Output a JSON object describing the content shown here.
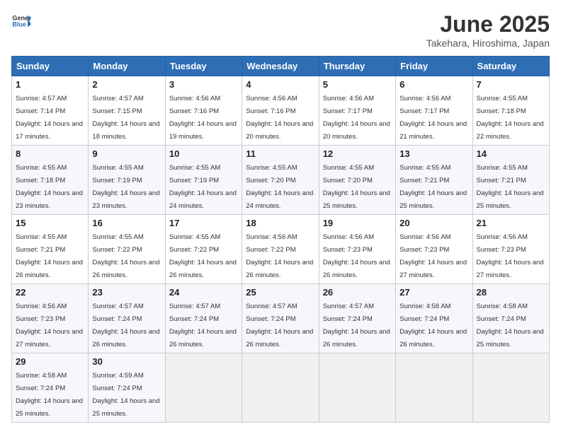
{
  "header": {
    "logo_general": "General",
    "logo_blue": "Blue",
    "title": "June 2025",
    "subtitle": "Takehara, Hiroshima, Japan"
  },
  "calendar": {
    "days_of_week": [
      "Sunday",
      "Monday",
      "Tuesday",
      "Wednesday",
      "Thursday",
      "Friday",
      "Saturday"
    ],
    "weeks": [
      [
        {
          "day": "",
          "sunrise": "",
          "sunset": "",
          "daylight": ""
        },
        {
          "day": "2",
          "sunrise": "4:57 AM",
          "sunset": "7:15 PM",
          "daylight": "14 hours and 18 minutes."
        },
        {
          "day": "3",
          "sunrise": "4:56 AM",
          "sunset": "7:16 PM",
          "daylight": "14 hours and 19 minutes."
        },
        {
          "day": "4",
          "sunrise": "4:56 AM",
          "sunset": "7:16 PM",
          "daylight": "14 hours and 20 minutes."
        },
        {
          "day": "5",
          "sunrise": "4:56 AM",
          "sunset": "7:17 PM",
          "daylight": "14 hours and 20 minutes."
        },
        {
          "day": "6",
          "sunrise": "4:56 AM",
          "sunset": "7:17 PM",
          "daylight": "14 hours and 21 minutes."
        },
        {
          "day": "7",
          "sunrise": "4:55 AM",
          "sunset": "7:18 PM",
          "daylight": "14 hours and 22 minutes."
        }
      ],
      [
        {
          "day": "8",
          "sunrise": "4:55 AM",
          "sunset": "7:18 PM",
          "daylight": "14 hours and 23 minutes."
        },
        {
          "day": "9",
          "sunrise": "4:55 AM",
          "sunset": "7:19 PM",
          "daylight": "14 hours and 23 minutes."
        },
        {
          "day": "10",
          "sunrise": "4:55 AM",
          "sunset": "7:19 PM",
          "daylight": "14 hours and 24 minutes."
        },
        {
          "day": "11",
          "sunrise": "4:55 AM",
          "sunset": "7:20 PM",
          "daylight": "14 hours and 24 minutes."
        },
        {
          "day": "12",
          "sunrise": "4:55 AM",
          "sunset": "7:20 PM",
          "daylight": "14 hours and 25 minutes."
        },
        {
          "day": "13",
          "sunrise": "4:55 AM",
          "sunset": "7:21 PM",
          "daylight": "14 hours and 25 minutes."
        },
        {
          "day": "14",
          "sunrise": "4:55 AM",
          "sunset": "7:21 PM",
          "daylight": "14 hours and 25 minutes."
        }
      ],
      [
        {
          "day": "15",
          "sunrise": "4:55 AM",
          "sunset": "7:21 PM",
          "daylight": "14 hours and 26 minutes."
        },
        {
          "day": "16",
          "sunrise": "4:55 AM",
          "sunset": "7:22 PM",
          "daylight": "14 hours and 26 minutes."
        },
        {
          "day": "17",
          "sunrise": "4:55 AM",
          "sunset": "7:22 PM",
          "daylight": "14 hours and 26 minutes."
        },
        {
          "day": "18",
          "sunrise": "4:56 AM",
          "sunset": "7:22 PM",
          "daylight": "14 hours and 26 minutes."
        },
        {
          "day": "19",
          "sunrise": "4:56 AM",
          "sunset": "7:23 PM",
          "daylight": "14 hours and 26 minutes."
        },
        {
          "day": "20",
          "sunrise": "4:56 AM",
          "sunset": "7:23 PM",
          "daylight": "14 hours and 27 minutes."
        },
        {
          "day": "21",
          "sunrise": "4:56 AM",
          "sunset": "7:23 PM",
          "daylight": "14 hours and 27 minutes."
        }
      ],
      [
        {
          "day": "22",
          "sunrise": "4:56 AM",
          "sunset": "7:23 PM",
          "daylight": "14 hours and 27 minutes."
        },
        {
          "day": "23",
          "sunrise": "4:57 AM",
          "sunset": "7:24 PM",
          "daylight": "14 hours and 26 minutes."
        },
        {
          "day": "24",
          "sunrise": "4:57 AM",
          "sunset": "7:24 PM",
          "daylight": "14 hours and 26 minutes."
        },
        {
          "day": "25",
          "sunrise": "4:57 AM",
          "sunset": "7:24 PM",
          "daylight": "14 hours and 26 minutes."
        },
        {
          "day": "26",
          "sunrise": "4:57 AM",
          "sunset": "7:24 PM",
          "daylight": "14 hours and 26 minutes."
        },
        {
          "day": "27",
          "sunrise": "4:58 AM",
          "sunset": "7:24 PM",
          "daylight": "14 hours and 26 minutes."
        },
        {
          "day": "28",
          "sunrise": "4:58 AM",
          "sunset": "7:24 PM",
          "daylight": "14 hours and 25 minutes."
        }
      ],
      [
        {
          "day": "29",
          "sunrise": "4:58 AM",
          "sunset": "7:24 PM",
          "daylight": "14 hours and 25 minutes."
        },
        {
          "day": "30",
          "sunrise": "4:59 AM",
          "sunset": "7:24 PM",
          "daylight": "14 hours and 25 minutes."
        },
        {
          "day": "",
          "sunrise": "",
          "sunset": "",
          "daylight": ""
        },
        {
          "day": "",
          "sunrise": "",
          "sunset": "",
          "daylight": ""
        },
        {
          "day": "",
          "sunrise": "",
          "sunset": "",
          "daylight": ""
        },
        {
          "day": "",
          "sunrise": "",
          "sunset": "",
          "daylight": ""
        },
        {
          "day": "",
          "sunrise": "",
          "sunset": "",
          "daylight": ""
        }
      ]
    ],
    "first_week_sunday": {
      "day": "1",
      "sunrise": "4:57 AM",
      "sunset": "7:14 PM",
      "daylight": "14 hours and 17 minutes."
    }
  }
}
